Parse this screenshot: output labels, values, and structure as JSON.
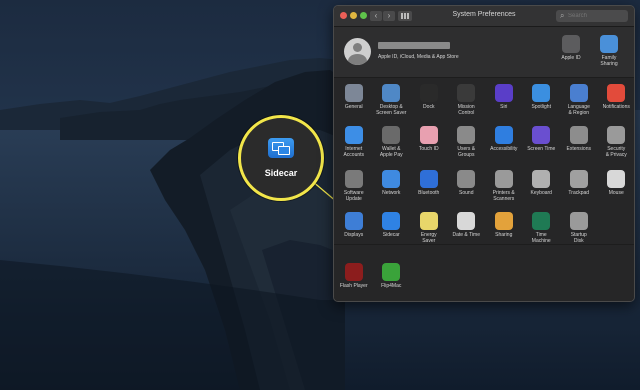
{
  "callout": {
    "label": "Sidecar"
  },
  "window": {
    "title": "System Preferences",
    "search_placeholder": "Search",
    "back_glyph": "‹",
    "forward_glyph": "›"
  },
  "account": {
    "subtitle": "Apple ID, iCloud, Media & App Store",
    "items": [
      {
        "label": "Apple ID",
        "icon": "apple-id-icon"
      },
      {
        "label": "Family\nSharing",
        "icon": "family-sharing-icon"
      }
    ]
  },
  "rows": [
    [
      {
        "label": "General",
        "icon": "general-icon",
        "color": "#7d8797"
      },
      {
        "label": "Desktop &\nScreen Saver",
        "icon": "desktop-screensaver-icon",
        "color": "#4f88c6"
      },
      {
        "label": "Dock",
        "icon": "dock-icon",
        "color": "#2a2a2a"
      },
      {
        "label": "Mission\nControl",
        "icon": "mission-control-icon",
        "color": "#3a3a3a"
      },
      {
        "label": "Siri",
        "icon": "siri-icon",
        "color": "#5a3ec8"
      },
      {
        "label": "Spotlight",
        "icon": "spotlight-icon",
        "color": "#3b8fe0"
      },
      {
        "label": "Language\n& Region",
        "icon": "language-region-icon",
        "color": "#4a7fd0"
      },
      {
        "label": "Notifications",
        "icon": "notifications-icon",
        "color": "#e24b3b"
      }
    ],
    [
      {
        "label": "Internet\nAccounts",
        "icon": "internet-accounts-icon",
        "color": "#3d8ee6"
      },
      {
        "label": "Wallet &\nApple Pay",
        "icon": "wallet-icon",
        "color": "#6a6a6a"
      },
      {
        "label": "Touch ID",
        "icon": "touch-id-icon",
        "color": "#e8a0b0"
      },
      {
        "label": "Users &\nGroups",
        "icon": "users-groups-icon",
        "color": "#8a8a8a"
      },
      {
        "label": "Accessibility",
        "icon": "accessibility-icon",
        "color": "#2f7ee0"
      },
      {
        "label": "Screen Time",
        "icon": "screen-time-icon",
        "color": "#6a4fd0"
      },
      {
        "label": "Extensions",
        "icon": "extensions-icon",
        "color": "#8d8d8d"
      },
      {
        "label": "Security\n& Privacy",
        "icon": "security-privacy-icon",
        "color": "#9a9a9a"
      }
    ],
    [
      {
        "label": "Software\nUpdate",
        "icon": "software-update-icon",
        "color": "#7a7a7a"
      },
      {
        "label": "Network",
        "icon": "network-icon",
        "color": "#3f8ae0"
      },
      {
        "label": "Bluetooth",
        "icon": "bluetooth-icon",
        "color": "#2f6fd8"
      },
      {
        "label": "Sound",
        "icon": "sound-icon",
        "color": "#8a8a8a"
      },
      {
        "label": "Printers &\nScanners",
        "icon": "printers-scanners-icon",
        "color": "#9a9a9a"
      },
      {
        "label": "Keyboard",
        "icon": "keyboard-icon",
        "color": "#b0b0b0"
      },
      {
        "label": "Trackpad",
        "icon": "trackpad-icon",
        "color": "#a0a0a0"
      },
      {
        "label": "Mouse",
        "icon": "mouse-icon",
        "color": "#d8d8d8"
      }
    ],
    [
      {
        "label": "Displays",
        "icon": "displays-icon",
        "color": "#3e7ed6"
      },
      {
        "label": "Sidecar",
        "icon": "sidecar-icon",
        "color": "#2f82e4"
      },
      {
        "label": "Energy\nSaver",
        "icon": "energy-saver-icon",
        "color": "#e8d66a"
      },
      {
        "label": "Date & Time",
        "icon": "date-time-icon",
        "color": "#d8d8d8"
      },
      {
        "label": "Sharing",
        "icon": "sharing-icon",
        "color": "#e3a23b"
      },
      {
        "label": "Time\nMachine",
        "icon": "time-machine-icon",
        "color": "#1f7a54"
      },
      {
        "label": "Startup\nDisk",
        "icon": "startup-disk-icon",
        "color": "#9a9a9a"
      }
    ],
    [
      {
        "label": "Flash Player",
        "icon": "flash-player-icon",
        "color": "#8c1d1d"
      },
      {
        "label": "Flip4Mac",
        "icon": "flip4mac-icon",
        "color": "#3aa33a"
      }
    ]
  ],
  "colors": {
    "highlight": "#f2e64a",
    "window_bg": "#262627"
  }
}
